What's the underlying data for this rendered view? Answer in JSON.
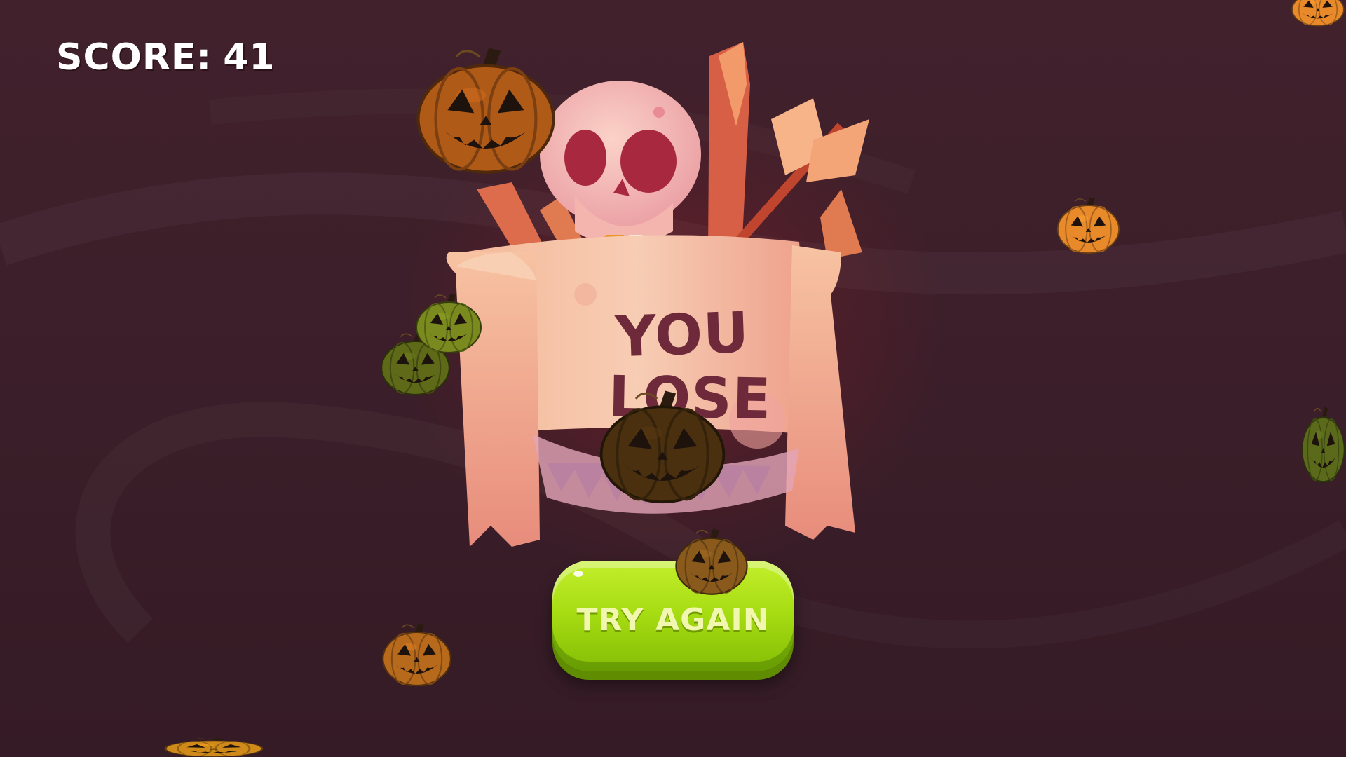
{
  "hud": {
    "score_label": "SCORE:",
    "score_value": "41"
  },
  "sign": {
    "line1": "YOU",
    "line2": "LOSE"
  },
  "button": {
    "label": "TRY AGAIN"
  },
  "colors": {
    "background": "#3c1f2a",
    "pumpkin_orange": "#e8892a",
    "pumpkin_dark_orange": "#b05a18",
    "pumpkin_green": "#6e7a1c",
    "pumpkin_brown": "#5a3b14",
    "button_green": "#a6dc12",
    "sign_text": "#6e2a3a"
  },
  "icons": {
    "skull": "skull-icon",
    "scroll": "parchment-scroll",
    "pumpkin": "jack-o-lantern-icon",
    "arrow": "feathered-arrow",
    "stake": "wooden-stake"
  }
}
